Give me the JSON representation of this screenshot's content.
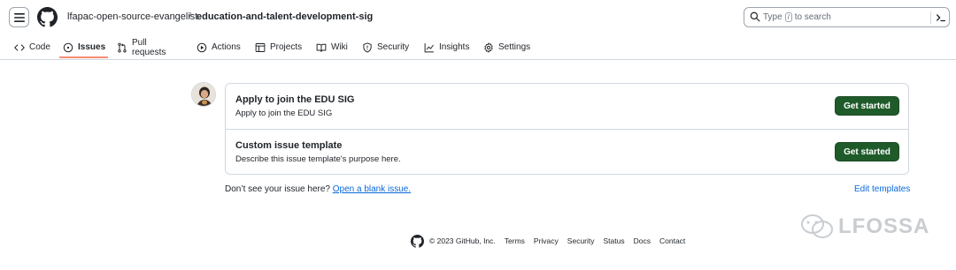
{
  "header": {
    "owner": "lfapac-open-source-evangelist",
    "separator": "/",
    "repo": "education-and-talent-development-sig",
    "search": {
      "prefix": "Type",
      "key": "/",
      "suffix": "to search"
    }
  },
  "tabs": [
    {
      "label": "Code",
      "icon": "code-icon"
    },
    {
      "label": "Issues",
      "icon": "issue-opened-icon",
      "active": true
    },
    {
      "label": "Pull requests",
      "icon": "git-pull-request-icon"
    },
    {
      "label": "Actions",
      "icon": "play-icon"
    },
    {
      "label": "Projects",
      "icon": "table-icon"
    },
    {
      "label": "Wiki",
      "icon": "book-icon"
    },
    {
      "label": "Security",
      "icon": "shield-icon"
    },
    {
      "label": "Insights",
      "icon": "graph-icon"
    },
    {
      "label": "Settings",
      "icon": "gear-icon"
    }
  ],
  "templates": [
    {
      "title": "Apply to join the EDU SIG",
      "description": "Apply to join the EDU SIG",
      "button": "Get started"
    },
    {
      "title": "Custom issue template",
      "description": "Describe this issue template's purpose here.",
      "button": "Get started"
    }
  ],
  "blank_issue": {
    "prompt": "Don’t see your issue here?",
    "link": "Open a blank issue."
  },
  "edit_templates": "Edit templates",
  "footer": {
    "copyright": "© 2023 GitHub, Inc.",
    "links": [
      "Terms",
      "Privacy",
      "Security",
      "Status",
      "Docs",
      "Contact"
    ]
  },
  "watermark": "LFOSSA",
  "colors": {
    "accent_underline": "#fd8c73",
    "button_green": "#1f5b2a",
    "link_blue": "#0969da"
  }
}
